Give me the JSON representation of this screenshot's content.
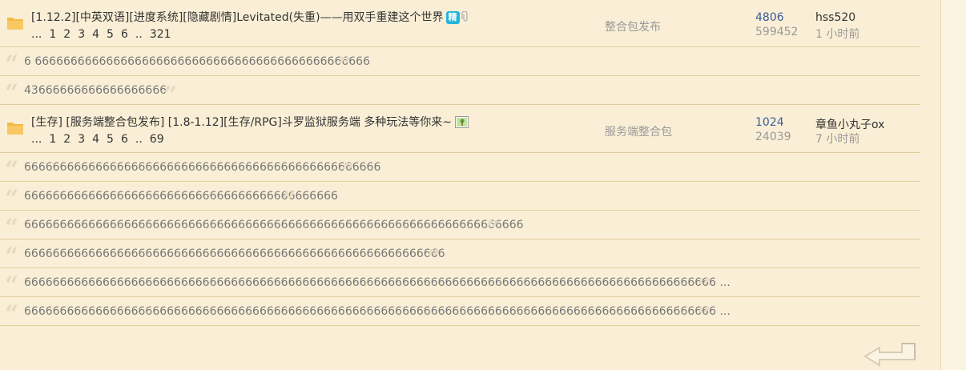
{
  "threads": [
    {
      "title": "[1.12.2][中英双语][进度系统][隐藏剧情]Levitated(失重)——用双手重建这个世界",
      "badge": "精",
      "pages": [
        "...",
        "1",
        "2",
        "3",
        "4",
        "5",
        "6",
        "..",
        "321"
      ],
      "category": "整合包发布",
      "replies": "4806",
      "views": "599452",
      "last_user": "hss520",
      "last_time": "1 小时前"
    },
    {
      "title": "[生存] [服务端整合包发布] [1.8-1.12][生存/RPG]斗罗监狱服务端 多种玩法等你来~",
      "pages": [
        "...",
        "1",
        "2",
        "3",
        "4",
        "5",
        "6",
        "..",
        "69"
      ],
      "category": "服务端整合包",
      "replies": "1024",
      "views": "24039",
      "last_user": "章鱼小丸子ox",
      "last_time": "7 小时前"
    }
  ],
  "replies_a": [
    "6 66666666666666666666666666666666666666666666666",
    "43666666666666666666"
  ],
  "replies_b": [
    "66666666666666666666666666666666666666666666666666",
    "66666666666666666666666666666666666666666666",
    "6666666666666666666666666666666666666666666666666666666666666666666666",
    "66666666666666666666666666666666666666666666666666666666666",
    "6666666666666666666666666666666666666666666666666666666666666666666666666666666666666666666666666 ...",
    "6666666666666666666666666666666666666666666666666666666666666666666666666666666666666666666666666 ..."
  ],
  "colors": {
    "background": "#faefd6",
    "divider": "#e2cd9c",
    "link_blue": "#3a5c9a",
    "muted": "#999999",
    "badge": "#21b5d8",
    "folder": "#f5b942"
  },
  "icons": {
    "folder": "folder-icon",
    "attachment": "paperclip-icon",
    "image": "image-icon",
    "quote_open": "quote-open-icon",
    "quote_close": "quote-close-icon",
    "return": "return-arrow-icon"
  }
}
